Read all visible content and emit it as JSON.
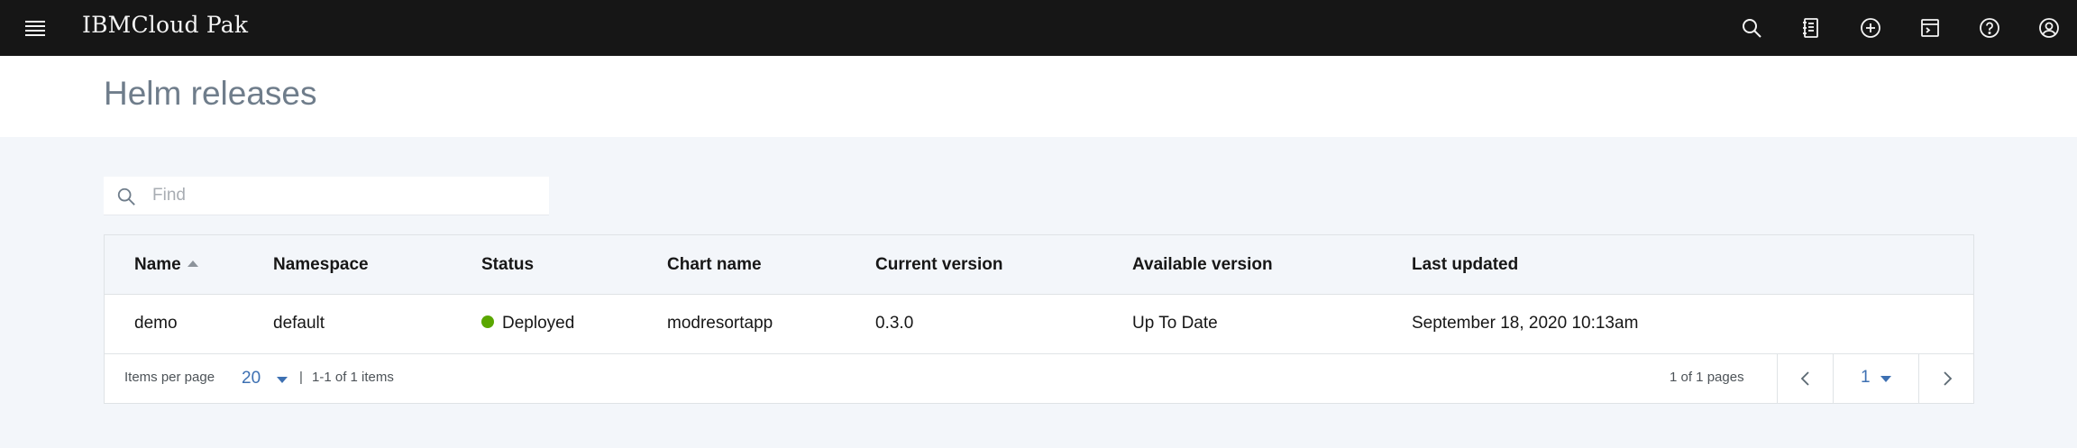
{
  "header": {
    "brand": "IBMCloud Pak",
    "icons": [
      "search-icon",
      "catalog-icon",
      "add-icon",
      "terminal-icon",
      "help-icon",
      "user-icon"
    ],
    "background": "#161616"
  },
  "page": {
    "title": "Helm releases"
  },
  "search": {
    "placeholder": "Find",
    "value": ""
  },
  "table": {
    "columns": [
      "Name",
      "Namespace",
      "Status",
      "Chart name",
      "Current version",
      "Available version",
      "Last updated"
    ],
    "sorted_column": "Name",
    "sort_direction": "ascending",
    "rows": [
      {
        "name": "demo",
        "namespace": "default",
        "status": "Deployed",
        "status_color": "#5aa700",
        "chart_name": "modresortapp",
        "current_version": "0.3.0",
        "available_version": "Up To Date",
        "last_updated": "September 18, 2020 10:13am"
      }
    ]
  },
  "pagination": {
    "items_per_page_label": "Items per page",
    "items_per_page": "20",
    "range_text": "1-1 of 1 items",
    "pages_text": "1 of 1 pages",
    "current_page": "1",
    "divider": "|"
  },
  "colors": {
    "accent": "#3d70b2",
    "page_bg": "#f3f6fa"
  }
}
